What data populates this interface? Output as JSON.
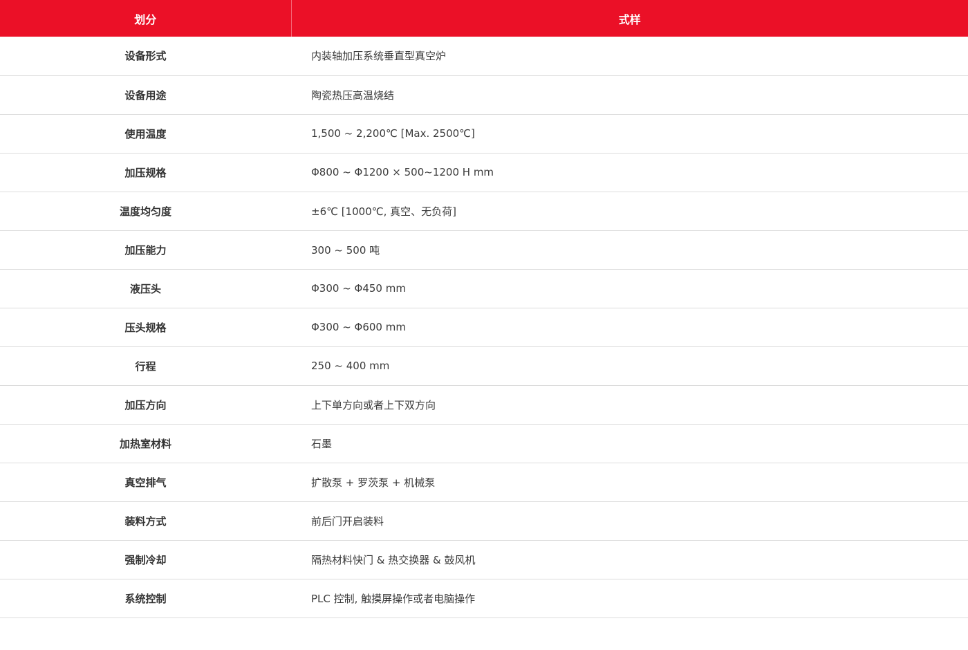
{
  "table": {
    "header": {
      "col1": "划分",
      "col2": "式样"
    },
    "rows": [
      {
        "label": "设备形式",
        "value": "内装轴加压系统垂直型真空炉"
      },
      {
        "label": "设备用途",
        "value": "陶瓷热压高温烧结"
      },
      {
        "label": "使用温度",
        "value": "1,500 ~ 2,200℃ [Max. 2500℃]"
      },
      {
        "label": "加压规格",
        "value": "Φ800 ~ Φ1200 × 500~1200 H mm"
      },
      {
        "label": "温度均匀度",
        "value": "±6℃ [1000℃, 真空、无负荷]"
      },
      {
        "label": "加压能力",
        "value": "300 ~ 500 吨"
      },
      {
        "label": "液压头",
        "value": "Φ300 ~ Φ450 mm"
      },
      {
        "label": "压头规格",
        "value": "Φ300 ~ Φ600 mm"
      },
      {
        "label": "行程",
        "value": "250 ~ 400 mm"
      },
      {
        "label": "加压方向",
        "value": "上下单方向或者上下双方向"
      },
      {
        "label": "加热室材料",
        "value": "石墨"
      },
      {
        "label": "真空排气",
        "value": "扩散泵 + 罗茨泵 + 机械泵"
      },
      {
        "label": "装料方式",
        "value": "前后门开启装料"
      },
      {
        "label": "强制冷却",
        "value": "隔热材料快门 & 热交换器 & 鼓风机"
      },
      {
        "label": "系统控制",
        "value": "PLC 控制, 触摸屏操作或者电脑操作"
      }
    ]
  },
  "colors": {
    "header_bg": "#eb1027",
    "header_text": "#ffffff",
    "row_border": "#dcdcdc"
  }
}
